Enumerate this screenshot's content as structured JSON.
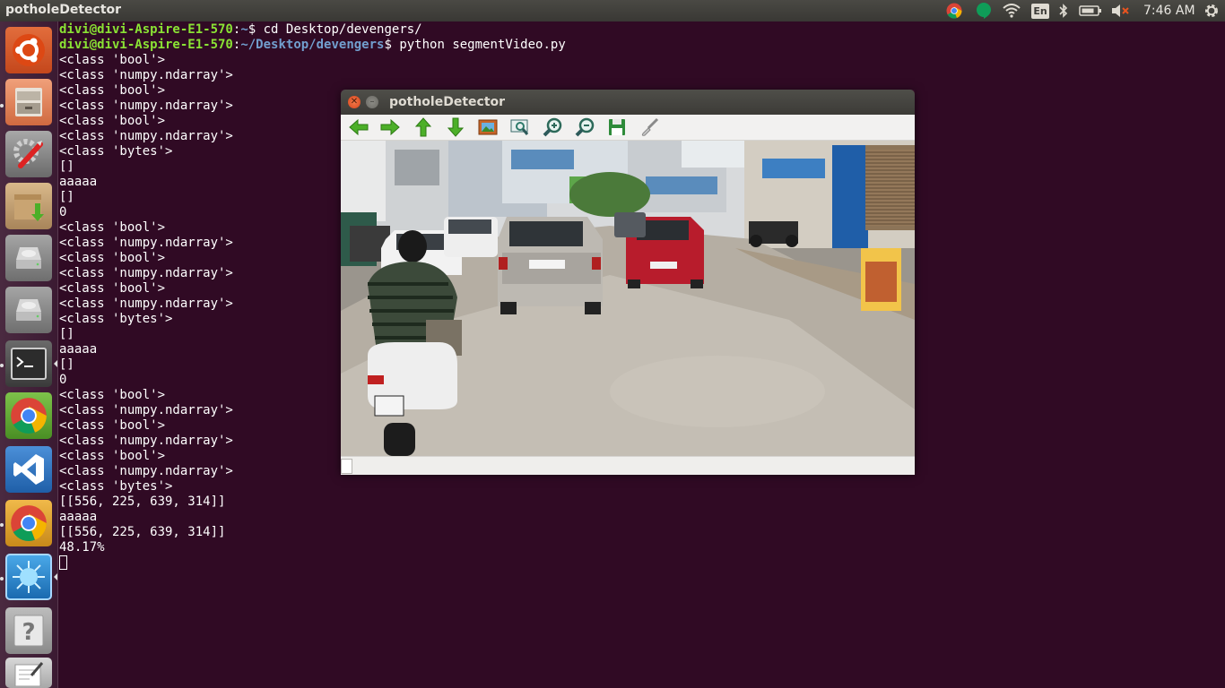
{
  "panel": {
    "app_title": "potholeDetector",
    "clock": "7:46 AM",
    "keyboard_layout": "En",
    "tray_icons": [
      "chrome-icon",
      "hangouts-icon",
      "wifi-icon",
      "keyboard-icon",
      "bluetooth-icon",
      "battery-icon",
      "volume-muted-icon",
      "settings-gear-icon"
    ]
  },
  "launcher": {
    "items": [
      "ubuntu-logo-icon",
      "file-cabinet-icon",
      "system-settings-icon",
      "software-updater-icon",
      "drive-icon",
      "drive-icon",
      "terminal-icon",
      "chrome-icon",
      "vscode-icon",
      "chrome-icon",
      "spark-app-icon",
      "help-icon",
      "text-editor-icon"
    ]
  },
  "terminal": {
    "line1": {
      "user": "divi@divi-Aspire-E1-570",
      "sep": ":",
      "path": "~",
      "cmd": "$ cd Desktop/devengers/"
    },
    "line2": {
      "user": "divi@divi-Aspire-E1-570",
      "sep": ":",
      "path": "~/Desktop/devengers",
      "cmd": "$ python segmentVideo.py"
    },
    "output": [
      "<class 'bool'>",
      "<class 'numpy.ndarray'>",
      "<class 'bool'>",
      "<class 'numpy.ndarray'>",
      "<class 'bool'>",
      "<class 'numpy.ndarray'>",
      "<class 'bytes'>",
      "[]",
      "aaaaa",
      "[]",
      "0",
      "<class 'bool'>",
      "<class 'numpy.ndarray'>",
      "<class 'bool'>",
      "<class 'numpy.ndarray'>",
      "<class 'bool'>",
      "<class 'numpy.ndarray'>",
      "<class 'bytes'>",
      "[]",
      "aaaaa",
      "[]",
      "0",
      "<class 'bool'>",
      "<class 'numpy.ndarray'>",
      "<class 'bool'>",
      "<class 'numpy.ndarray'>",
      "<class 'bool'>",
      "<class 'numpy.ndarray'>",
      "<class 'bytes'>",
      "[[556, 225, 639, 314]]",
      "aaaaa",
      "[[556, 225, 639, 314]]",
      "48.17%"
    ]
  },
  "viewer": {
    "title": "potholeDetector",
    "toolbar": [
      "arrow-left-icon",
      "arrow-right-icon",
      "arrow-up-icon",
      "arrow-down-icon",
      "image-icon",
      "zoom-fit-icon",
      "zoom-in-icon",
      "zoom-out-icon",
      "save-icon",
      "brush-icon"
    ]
  },
  "colors": {
    "terminal_bg": "#300a24",
    "prompt_user": "#8ae234",
    "prompt_path": "#729fcf",
    "panel_bg": "#3c3b37",
    "close_button": "#e95420"
  }
}
